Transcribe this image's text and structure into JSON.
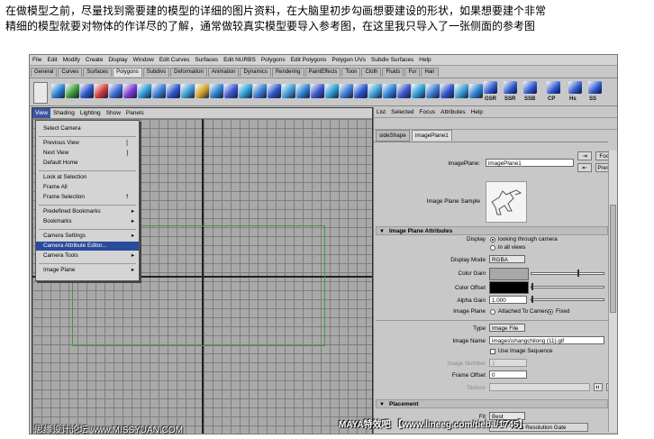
{
  "intro": {
    "line1": "在做模型之前，尽量找到需要建的模型的详细的图片资料，在大脑里初步勾画想要建设的形状，如果想要建个非常",
    "line2": "精细的模型就要对物体的作详尽的了解，通常做较真实模型要导入参考图，在这里我只导入了一张侧面的参考图"
  },
  "menubar": [
    "File",
    "Edit",
    "Modify",
    "Create",
    "Display",
    "Window",
    "Edit Curves",
    "Surfaces",
    "Edit NURBS",
    "Polygons",
    "Edit Polygons",
    "Polygon UVs",
    "Subdiv Surfaces",
    "Help"
  ],
  "shelf_tabs": [
    "General",
    "Curves",
    "Surfaces",
    "Polygons",
    "Subdivs",
    "Deformation",
    "Animation",
    "Dynamics",
    "Rendering",
    "PaintEffects",
    "Toon",
    "Cloth",
    "Fluids",
    "Fur",
    "Hair"
  ],
  "shelf_active": "Polygons",
  "shelf_labels": [
    "GSR",
    "SSR",
    "SSB",
    "CP",
    "Hs",
    "SS"
  ],
  "viewport_menu": [
    "View",
    "Shading",
    "Lighting",
    "Show",
    "Panels"
  ],
  "view_menu": [
    {
      "label": "Select Camera",
      "shortcut": "",
      "arrow": false
    },
    {
      "label": "Previous View",
      "shortcut": "[",
      "arrow": false
    },
    {
      "label": "Next View",
      "shortcut": "]",
      "arrow": false
    },
    {
      "label": "Default Home",
      "shortcut": "",
      "arrow": false
    },
    {
      "label": "Look at Selection",
      "shortcut": "",
      "arrow": false
    },
    {
      "label": "Frame All",
      "shortcut": "",
      "arrow": false
    },
    {
      "label": "Frame Selection",
      "shortcut": "f",
      "arrow": false
    },
    {
      "label": "Predefined Bookmarks",
      "shortcut": "",
      "arrow": true
    },
    {
      "label": "Bookmarks",
      "shortcut": "",
      "arrow": true
    },
    {
      "label": "Camera Settings",
      "shortcut": "",
      "arrow": true
    },
    {
      "label": "Camera Attribute Editor...",
      "shortcut": "",
      "arrow": false
    },
    {
      "label": "Camera Tools",
      "shortcut": "",
      "arrow": true
    },
    {
      "label": "Image Plane",
      "shortcut": "",
      "arrow": true
    }
  ],
  "view_menu_highlighted": "Camera Attribute Editor...",
  "ae": {
    "menu": [
      "List",
      "Selected",
      "Focus",
      "Attributes",
      "Help"
    ],
    "tabs": [
      "sideShape",
      "imagePlane1"
    ],
    "active_tab": "imagePlane1",
    "imagePlane_label": "imagePlane:",
    "imagePlane_value": "imagePlane1",
    "focus_label": "Focus",
    "presets_label": "Presets",
    "sample_label": "Image Plane Sample",
    "section_attrs": "Image Plane Attributes",
    "display_label": "Display",
    "display_opt1": "looking through camera",
    "display_opt2": "in all views",
    "display_mode_label": "Display Mode",
    "display_mode_value": "RGBA",
    "color_gain_label": "Color Gain",
    "color_offset_label": "Color Offset",
    "alpha_gain_label": "Alpha Gain",
    "alpha_gain_value": "1.000",
    "image_plane_label": "Image Plane",
    "attached_label": "Attached To Camera",
    "fixed_label": "Fixed",
    "type_label": "Type",
    "type_value": "Image File",
    "image_name_label": "Image Name",
    "image_name_value": "images\\shangchilong (11).gif",
    "use_seq_label": "Use Image Sequence",
    "image_number_label": "Image Number",
    "image_number_value": "1",
    "frame_offset_label": "Frame Offset",
    "frame_offset_value": "0",
    "texture_label": "Texture",
    "section_placement": "Placement",
    "fit_label": "Fit",
    "fit_value": "Best",
    "fit_button": "Fit to Resolution Gate"
  },
  "watermark_left": "思缘设计论坛 www.MISSYUAN.COM",
  "watermark_right": "MAYA特效吧 【www.lineeg.com/tieba/1745】",
  "colors": {
    "menu_highlight": "#2a4a9a",
    "gate_green": "#3f9a3f",
    "grid": "#a9a9a9"
  }
}
